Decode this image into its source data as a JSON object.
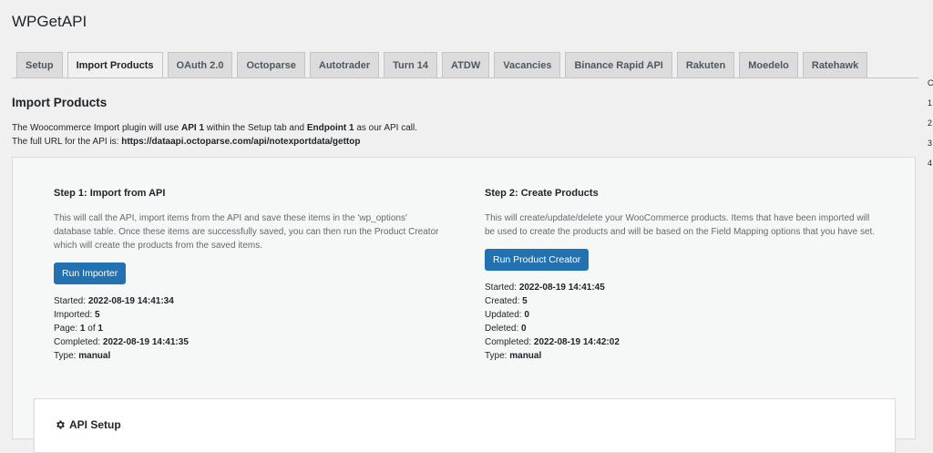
{
  "app": {
    "title": "WPGetAPI"
  },
  "tabs": [
    {
      "label": "Setup",
      "active": false
    },
    {
      "label": "Import Products",
      "active": true
    },
    {
      "label": "OAuth 2.0",
      "active": false
    },
    {
      "label": "Octoparse",
      "active": false
    },
    {
      "label": "Autotrader",
      "active": false
    },
    {
      "label": "Turn 14",
      "active": false
    },
    {
      "label": "ATDW",
      "active": false
    },
    {
      "label": "Vacancies",
      "active": false
    },
    {
      "label": "Binance Rapid API",
      "active": false
    },
    {
      "label": "Rakuten",
      "active": false
    },
    {
      "label": "Moedelo",
      "active": false
    },
    {
      "label": "Ratehawk",
      "active": false
    }
  ],
  "page": {
    "title": "Import Products",
    "intro_line1_a": "The Woocommerce Import plugin will use ",
    "intro_api": "API 1",
    "intro_line1_b": " within the Setup tab and ",
    "intro_endpoint": "Endpoint 1",
    "intro_line1_c": " as our API call.",
    "intro_line2_a": "The full URL for the API is: ",
    "intro_url": "https://dataapi.octoparse.com/api/notexportdata/gettop"
  },
  "step1": {
    "title": "Step 1: Import from API",
    "description": "This will call the API, import items from the API and save these items in the 'wp_options' database table. Once these items are successfully saved, you can then run the Product Creator which will create the products from the saved items.",
    "button_label": "Run Importer",
    "started_label": "Started:",
    "started": "2022-08-19 14:41:34",
    "imported_label": "Imported:",
    "imported": "5",
    "page_label": "Page:",
    "page_current": "1",
    "page_of": "of",
    "page_total": "1",
    "completed_label": "Completed:",
    "completed": "2022-08-19 14:41:35",
    "type_label": "Type:",
    "type": "manual"
  },
  "step2": {
    "title": "Step 2: Create Products",
    "description": "This will create/update/delete your WooCommerce products. Items that have been imported will be used to create the products and will be based on the Field Mapping options that you have set.",
    "button_label": "Run Product Creator",
    "started_label": "Started:",
    "started": "2022-08-19 14:41:45",
    "created_label": "Created:",
    "created": "5",
    "updated_label": "Updated:",
    "updated": "0",
    "deleted_label": "Deleted:",
    "deleted": "0",
    "completed_label": "Completed:",
    "completed": "2022-08-19 14:42:02",
    "type_label": "Type:",
    "type": "manual"
  },
  "api_setup": {
    "title": "API Setup",
    "icon": "gear-icon"
  },
  "edge": {
    "chars": [
      "C",
      "1",
      "2",
      "3",
      "4"
    ]
  },
  "colors": {
    "primary": "#2271b1",
    "background": "#f0f0f1",
    "tab_inactive": "#dcdcde"
  }
}
